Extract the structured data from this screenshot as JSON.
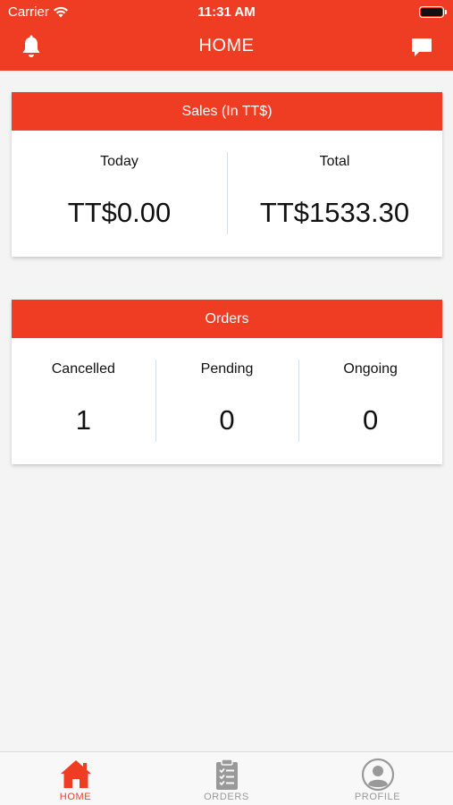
{
  "status_bar": {
    "carrier": "Carrier",
    "time": "11:31 AM",
    "icons": [
      "wifi-icon",
      "battery-icon"
    ]
  },
  "nav": {
    "title": "HOME",
    "left_icon": "bell-icon",
    "right_icon": "chat-bubble-icon"
  },
  "sales_card": {
    "header": "Sales (In TT$)",
    "cells": [
      {
        "label": "Today",
        "value": "TT$0.00"
      },
      {
        "label": "Total",
        "value": "TT$1533.30"
      }
    ]
  },
  "orders_card": {
    "header": "Orders",
    "cells": [
      {
        "label": "Cancelled",
        "value": "1"
      },
      {
        "label": "Pending",
        "value": "0"
      },
      {
        "label": "Ongoing",
        "value": "0"
      }
    ]
  },
  "tab_bar": {
    "tabs": [
      {
        "label": "HOME",
        "icon": "home-icon",
        "active": true
      },
      {
        "label": "ORDERS",
        "icon": "clipboard-list-icon",
        "active": false
      },
      {
        "label": "PROFILE",
        "icon": "user-circle-icon",
        "active": false
      }
    ]
  },
  "colors": {
    "brand": "#ef3d24",
    "background": "#f4f4f4",
    "tab_inactive": "#999999"
  }
}
